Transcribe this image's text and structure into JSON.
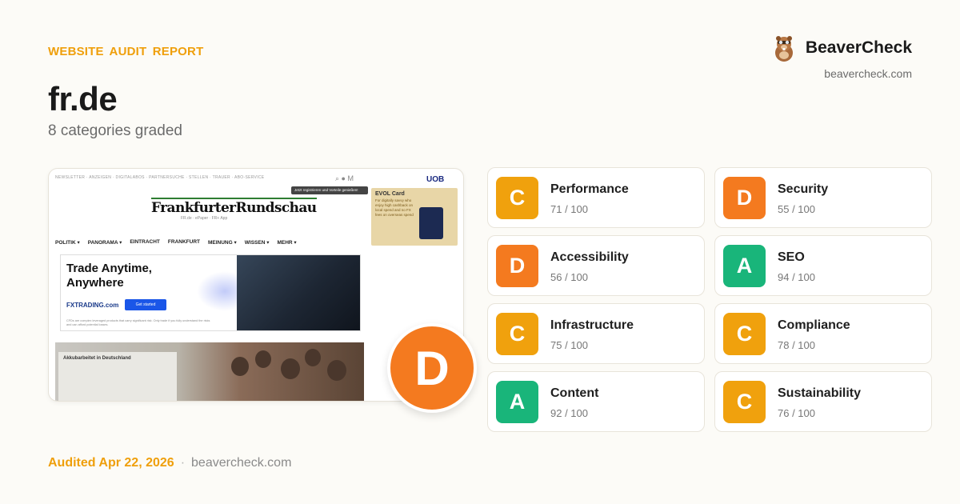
{
  "header": {
    "eyebrow": "WEBSITE AUDIT REPORT",
    "site": "fr.de",
    "subtitle": "8 categories graded"
  },
  "brand": {
    "name": "BeaverCheck",
    "url": "beavercheck.com",
    "icon": "beaver-icon"
  },
  "preview": {
    "topbar": "NEWSLETTER · ANZEIGEN · DIGITALABOS · PARTNERSUCHE · STELLEN · TRAUER · ABO-SERVICE",
    "tooltip": "Jetzt registrieren und Vorteile genießen!",
    "masthead": "FrankfurterRundschau",
    "masthead_sub": "FR.de · ePaper · FR+ App",
    "nav": [
      "POLITIK ▾",
      "PANORAMA ▾",
      "EINTRACHT",
      "FRANKFURT",
      "MEINUNG ▾",
      "WISSEN ▾",
      "MEHR ▾"
    ],
    "uob": "UOB",
    "evol_title": "EVOL Card",
    "evol_text": "For digitally savvy who enjoy high cashback on local spend and no FX fees on overseas spend",
    "ad_headline": "Trade Anytime, Anywhere",
    "ad_logo": "FXTRADING.com",
    "ad_button": "Get started",
    "ad_fine": "CFDs are complex leveraged products that carry significant risk. Only trade if you fully understand the risks and can afford potential losses.",
    "photo_slide_title": "Akkubarbeitet in Deutschland"
  },
  "overall_grade": "D",
  "categories": [
    {
      "name": "Performance",
      "score": "71 / 100",
      "grade": "C",
      "color": "#f0a10d"
    },
    {
      "name": "Security",
      "score": "55 / 100",
      "grade": "D",
      "color": "#f47a1f"
    },
    {
      "name": "Accessibility",
      "score": "56 / 100",
      "grade": "D",
      "color": "#f47a1f"
    },
    {
      "name": "SEO",
      "score": "94 / 100",
      "grade": "A",
      "color": "#19b57a"
    },
    {
      "name": "Infrastructure",
      "score": "75 / 100",
      "grade": "C",
      "color": "#f0a10d"
    },
    {
      "name": "Compliance",
      "score": "78 / 100",
      "grade": "C",
      "color": "#f0a10d"
    },
    {
      "name": "Content",
      "score": "92 / 100",
      "grade": "A",
      "color": "#19b57a"
    },
    {
      "name": "Sustainability",
      "score": "76 / 100",
      "grade": "C",
      "color": "#f0a10d"
    }
  ],
  "footer": {
    "audited": "Audited Apr 22, 2026",
    "separator": "·",
    "url": "beavercheck.com"
  },
  "colors": {
    "accent": "#ef9f0b",
    "grade_a": "#19b57a",
    "grade_c": "#f0a10d",
    "grade_d": "#f47a1f"
  }
}
